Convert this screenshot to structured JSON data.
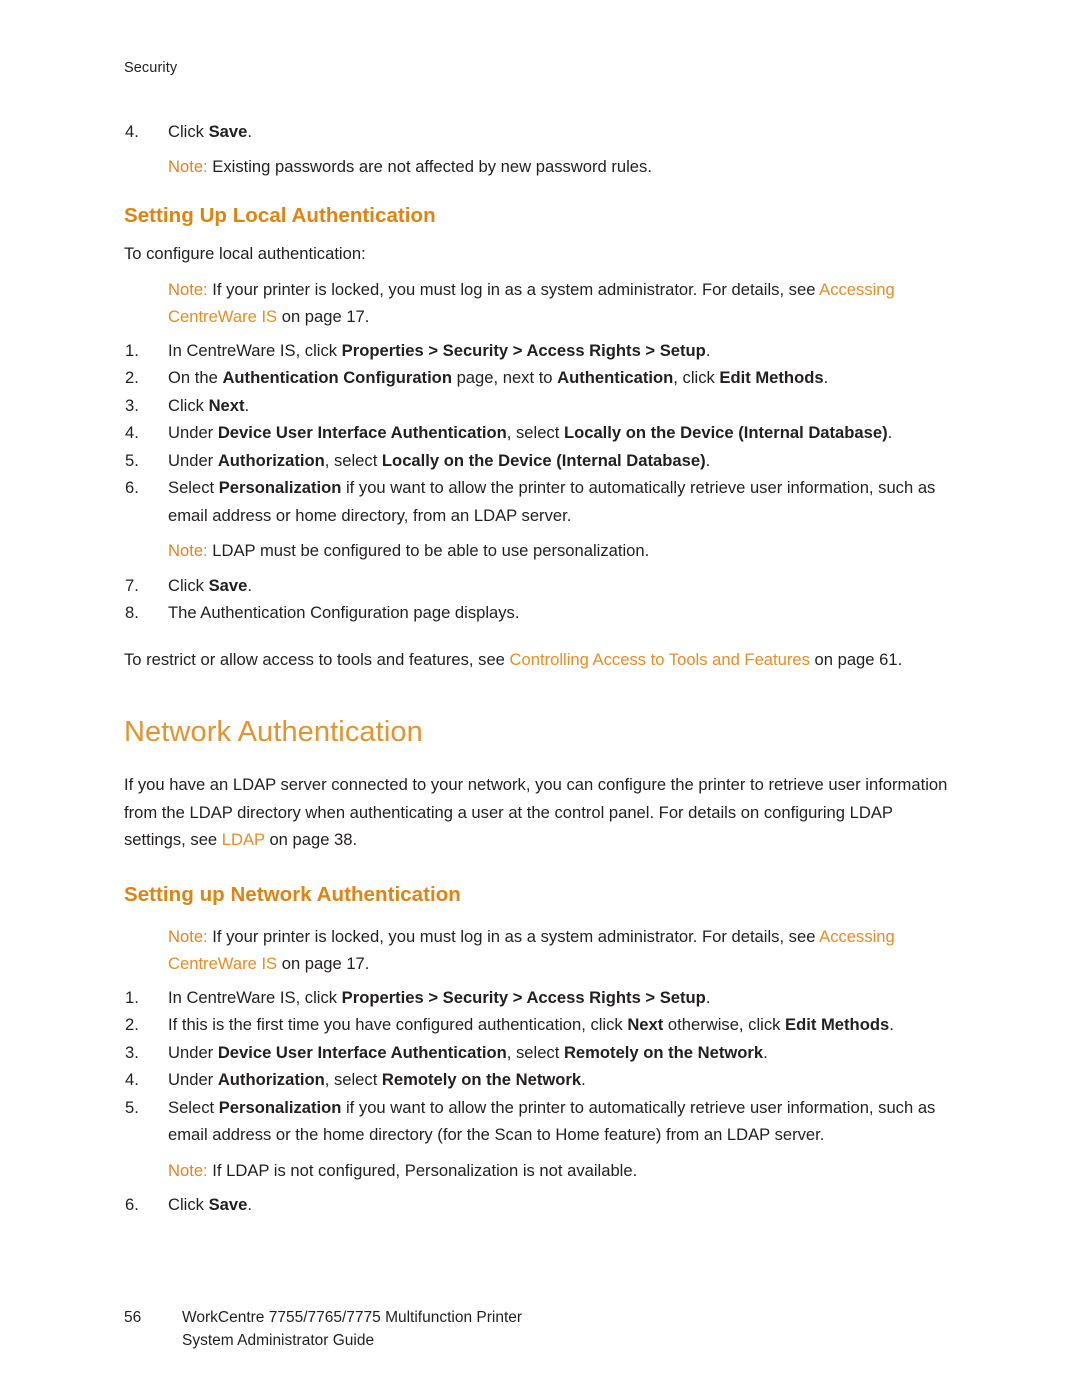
{
  "running_header": "Security",
  "footer": {
    "page_number": "56",
    "line1": "WorkCentre 7755/7765/7775 Multifunction Printer",
    "line2": "System Administrator Guide"
  },
  "colors": {
    "heading_chapter": "#E8922E",
    "heading_section": "#E2820F",
    "note_label": "#E8821E",
    "xref_link": "#EC8B24",
    "body_text": "#231F20"
  },
  "blocks": {
    "step4_prev": {
      "num": "4.",
      "text_pre": "Click ",
      "bold": "Save",
      "text_post": "."
    },
    "note_passwords": {
      "label": "Note:",
      "text": " Existing passwords are not affected by new password rules."
    },
    "heading_local_auth": "Setting Up Local Authentication",
    "intro_local_auth": "To configure local authentication:",
    "note_locked_1": {
      "label": "Note:",
      "t1": " If your printer is locked, you must log in as a system administrator. For details, see ",
      "link": "Accessing CentreWare IS",
      "t2": " on page 17."
    },
    "local_steps": [
      {
        "num": "1.",
        "parts": [
          {
            "t": "In CentreWare IS, click ",
            "b": false
          },
          {
            "t": "Properties > Security > Access Rights > Setup",
            "b": true
          },
          {
            "t": ".",
            "b": false
          }
        ]
      },
      {
        "num": "2.",
        "parts": [
          {
            "t": "On the ",
            "b": false
          },
          {
            "t": "Authentication Configuration",
            "b": true
          },
          {
            "t": " page, next to ",
            "b": false
          },
          {
            "t": "Authentication",
            "b": true
          },
          {
            "t": ", click ",
            "b": false
          },
          {
            "t": "Edit Methods",
            "b": true
          },
          {
            "t": ".",
            "b": false
          }
        ]
      },
      {
        "num": "3.",
        "parts": [
          {
            "t": "Click ",
            "b": false
          },
          {
            "t": "Next",
            "b": true
          },
          {
            "t": ".",
            "b": false
          }
        ]
      },
      {
        "num": "4.",
        "parts": [
          {
            "t": "Under ",
            "b": false
          },
          {
            "t": "Device User Interface Authentication",
            "b": true
          },
          {
            "t": ", select ",
            "b": false
          },
          {
            "t": "Locally on the Device (Internal Database)",
            "b": true
          },
          {
            "t": ".",
            "b": false
          }
        ]
      },
      {
        "num": "5.",
        "parts": [
          {
            "t": "Under ",
            "b": false
          },
          {
            "t": "Authorization",
            "b": true
          },
          {
            "t": ", select ",
            "b": false
          },
          {
            "t": "Locally on the Device (Internal Database)",
            "b": true
          },
          {
            "t": ".",
            "b": false
          }
        ]
      },
      {
        "num": "6.",
        "parts": [
          {
            "t": "Select ",
            "b": false
          },
          {
            "t": "Personalization",
            "b": true
          },
          {
            "t": " if you want to allow the printer to automatically retrieve user information, such as email address or home directory, from an LDAP server.",
            "b": false
          }
        ]
      }
    ],
    "note_ldap_personalization": {
      "label": "Note:",
      "text": " LDAP must be configured to be able to use personalization."
    },
    "local_steps_tail": [
      {
        "num": "7.",
        "parts": [
          {
            "t": "Click ",
            "b": false
          },
          {
            "t": "Save",
            "b": true
          },
          {
            "t": ".",
            "b": false
          }
        ]
      },
      {
        "num": "8.",
        "parts": [
          {
            "t": "The Authentication Configuration page displays.",
            "b": false
          }
        ]
      }
    ],
    "restrict_para": {
      "t1": "To restrict or allow access to tools and features, see ",
      "link": "Controlling Access to Tools and Features",
      "t2": " on page 61."
    },
    "heading_network_auth": "Network Authentication",
    "network_intro": "If you have an LDAP server connected to your network, you can configure the printer to retrieve user information from the LDAP directory when authenticating a user at the control panel. For details on configuring LDAP settings, see ",
    "network_intro_link": "LDAP",
    "network_intro_tail": " on page 38.",
    "heading_setting_up_network_auth": "Setting up Network Authentication",
    "note_locked_2": {
      "label": "Note:",
      "t1": " If your printer is locked, you must log in as a system administrator. For details, see ",
      "link": "Accessing CentreWare IS",
      "t2": " on page 17."
    },
    "network_steps": [
      {
        "num": "1.",
        "parts": [
          {
            "t": "In CentreWare IS, click ",
            "b": false
          },
          {
            "t": "Properties > Security > Access Rights > Setup",
            "b": true
          },
          {
            "t": ".",
            "b": false
          }
        ]
      },
      {
        "num": "2.",
        "parts": [
          {
            "t": "If this is the first time you have configured authentication, click ",
            "b": false
          },
          {
            "t": "Next",
            "b": true
          },
          {
            "t": " otherwise, click ",
            "b": false
          },
          {
            "t": "Edit Methods",
            "b": true
          },
          {
            "t": ".",
            "b": false
          }
        ]
      },
      {
        "num": "3.",
        "parts": [
          {
            "t": "Under ",
            "b": false
          },
          {
            "t": "Device User Interface Authentication",
            "b": true
          },
          {
            "t": ", select ",
            "b": false
          },
          {
            "t": "Remotely on the Network",
            "b": true
          },
          {
            "t": ".",
            "b": false
          }
        ]
      },
      {
        "num": "4.",
        "parts": [
          {
            "t": "Under ",
            "b": false
          },
          {
            "t": "Authorization",
            "b": true
          },
          {
            "t": ", select ",
            "b": false
          },
          {
            "t": "Remotely on the Network",
            "b": true
          },
          {
            "t": ".",
            "b": false
          }
        ]
      },
      {
        "num": "5.",
        "parts": [
          {
            "t": "Select ",
            "b": false
          },
          {
            "t": "Personalization",
            "b": true
          },
          {
            "t": " if you want to allow the printer to automatically retrieve user information, such as email address or the home directory (for the Scan to Home feature) from an LDAP server.",
            "b": false
          }
        ]
      }
    ],
    "note_ldap_not_configured": {
      "label": "Note:",
      "text": " If LDAP is not configured, Personalization is not available."
    },
    "network_steps_tail": [
      {
        "num": "6.",
        "parts": [
          {
            "t": "Click ",
            "b": false
          },
          {
            "t": "Save",
            "b": true
          },
          {
            "t": ".",
            "b": false
          }
        ]
      }
    ]
  }
}
